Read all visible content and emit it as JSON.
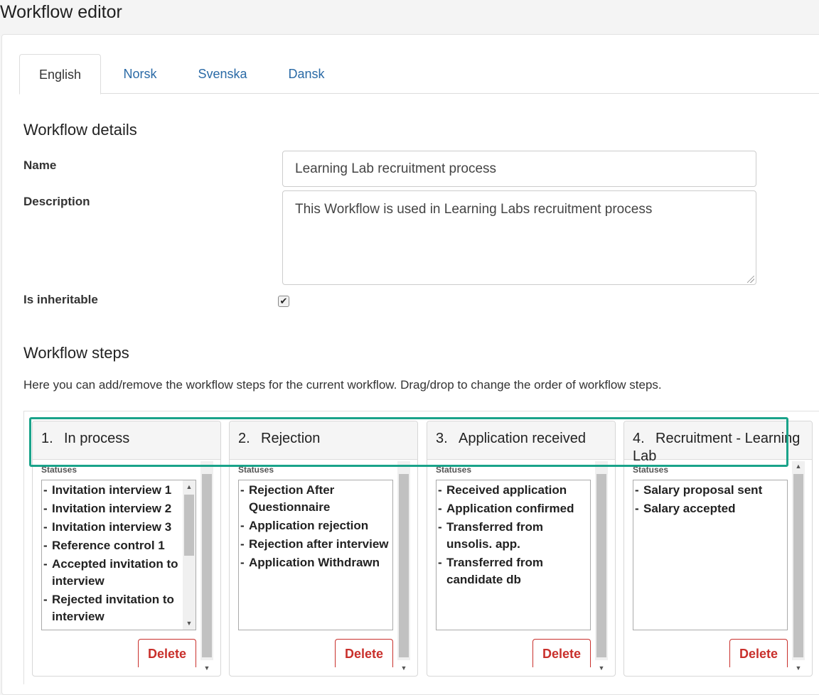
{
  "page": {
    "title": "Workflow editor"
  },
  "tabs": [
    {
      "label": "English",
      "active": true
    },
    {
      "label": "Norsk",
      "active": false
    },
    {
      "label": "Svenska",
      "active": false
    },
    {
      "label": "Dansk",
      "active": false
    }
  ],
  "details": {
    "heading": "Workflow details",
    "name_label": "Name",
    "name_value": "Learning Lab recruitment process",
    "description_label": "Description",
    "description_value": "This Workflow is used in Learning Labs recruitment process",
    "inheritable_label": "Is inheritable",
    "inheritable_checked": true,
    "inheritable_mark": "✔"
  },
  "steps_section": {
    "heading": "Workflow steps",
    "help_text": "Here you can add/remove the workflow steps for the current workflow. Drag/drop to change the order of workflow steps."
  },
  "steps": [
    {
      "number": "1.",
      "title": "In process",
      "statuses_label": "Statuses",
      "statuses": [
        "Invitation interview 1",
        "Invitation interview 2",
        "Invitation interview 3",
        "Reference control 1",
        "Accepted invitation to interview",
        "Rejected invitation to interview"
      ],
      "delete_label": "Delete"
    },
    {
      "number": "2.",
      "title": "Rejection",
      "statuses_label": "Statuses",
      "statuses": [
        "Rejection After Questionnaire",
        "Application rejection",
        "Rejection after interview",
        "Application Withdrawn"
      ],
      "delete_label": "Delete"
    },
    {
      "number": "3.",
      "title": "Application received",
      "statuses_label": "Statuses",
      "statuses": [
        "Received application",
        "Application confirmed",
        "Transferred from unsolis. app.",
        "Transferred from candidate db"
      ],
      "delete_label": "Delete"
    },
    {
      "number": "4.",
      "title": "Recruitment - Learning Lab",
      "statuses_label": "Statuses",
      "statuses": [
        "Salary proposal sent",
        " Salary accepted"
      ],
      "delete_label": "Delete"
    }
  ],
  "colors": {
    "highlight": "#1aa38a",
    "delete": "#c9302c",
    "link": "#2a6aa6"
  }
}
